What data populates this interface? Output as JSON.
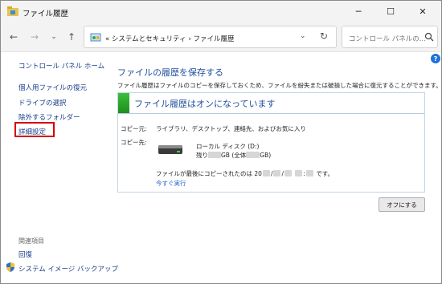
{
  "window": {
    "title": "ファイル履歴"
  },
  "titlebar": {
    "min_glyph": "─",
    "max_glyph": "☐",
    "close_glyph": "✕"
  },
  "nav": {
    "back_glyph": "←",
    "forward_glyph": "→",
    "recent_glyph": "⌄",
    "up_glyph": "↑",
    "address_text": "«  システムとセキュリティ  ›  ファイル履歴",
    "address_chevron": "⌄",
    "refresh_glyph": "↻",
    "search_placeholder": "コントロール パネルの..."
  },
  "sidebar": {
    "home": "コントロール パネル ホーム",
    "items": [
      {
        "label": "個人用ファイルの復元"
      },
      {
        "label": "ドライブの選択"
      },
      {
        "label": "除外するフォルダー"
      },
      {
        "label": "詳細設定"
      }
    ],
    "related_heading": "関連項目",
    "related": [
      {
        "label": "回復"
      },
      {
        "label": "システム イメージ バックアップ"
      }
    ]
  },
  "main": {
    "help_glyph": "?",
    "title": "ファイルの履歴を保存する",
    "description": "ファイル履歴はファイルのコピーを保存しておくため、ファイルを紛失または破損した場合に復元することができます。",
    "panel": {
      "status_title": "ファイル履歴はオンになっています",
      "copy_from_label": "コピー元:",
      "copy_from_value": "ライブラリ、デスクトップ、連絡先、およびお気に入り",
      "copy_to_label": "コピー先:",
      "drive_name": "ローカル ディスク (D:)",
      "space_prefix": "残り",
      "space_middle": "GB (全体",
      "space_suffix": "GB)",
      "last_copy_prefix": "ファイルが最後にコピーされたのは 20",
      "last_copy_suffix": "です。",
      "run_now": "今すぐ実行"
    },
    "off_button": "オフにする"
  },
  "colors": {
    "link": "#1a3c8a",
    "title_blue": "#1e4e9c",
    "status_green": "#2aa52a",
    "highlight_red": "#d40000"
  },
  "icons": [
    "app-icon",
    "back-icon",
    "forward-icon",
    "recent-locations-icon",
    "up-icon",
    "control-panel-icon",
    "refresh-icon",
    "search-icon",
    "help-icon",
    "shield-icon",
    "drive-icon"
  ]
}
